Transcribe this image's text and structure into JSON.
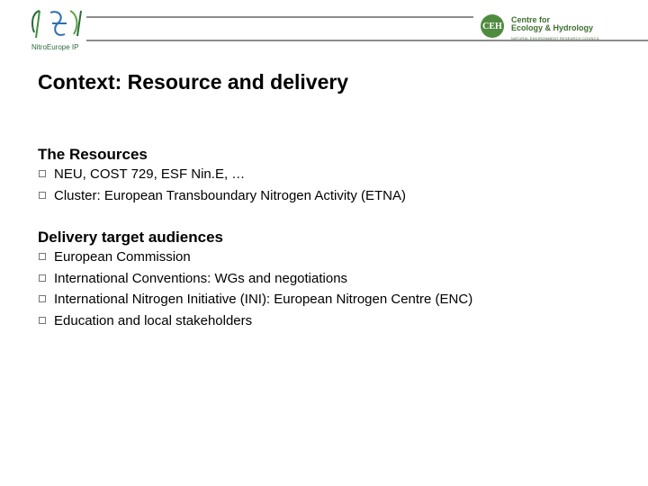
{
  "header": {
    "left_logo_text": "NitroEurope IP",
    "right_logo_badge": "CEH",
    "right_logo_name": "Centre for\nEcology & Hydrology",
    "right_logo_subtitle": "NATURAL ENVIRONMENT RESEARCH COUNCIL"
  },
  "slide": {
    "title": "Context: Resource and delivery",
    "sections": [
      {
        "heading": "The Resources",
        "items": [
          "NEU, COST 729, ESF Nin.E, …",
          "Cluster: European Transboundary Nitrogen Activity (ETNA)"
        ]
      },
      {
        "heading": "Delivery target audiences",
        "items": [
          "European Commission",
          "International Conventions: WGs and negotiations",
          "International Nitrogen Initiative (INI):  European Nitrogen Centre (ENC)",
          "Education and local stakeholders"
        ]
      }
    ]
  },
  "colors": {
    "rule": "#8c8c8c",
    "logo_green": "#4f8b3e",
    "ni_green": "#2a6b3a"
  }
}
